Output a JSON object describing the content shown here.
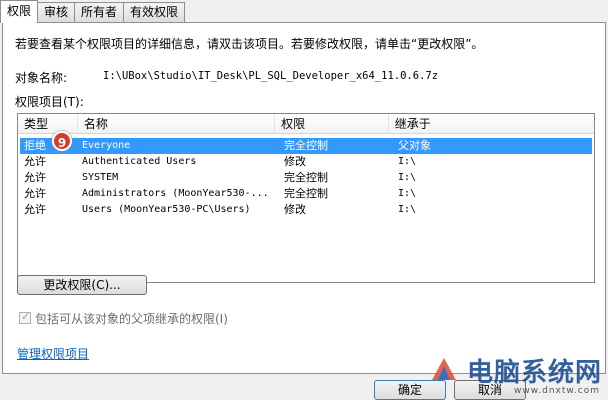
{
  "tabs": [
    "权限",
    "审核",
    "所有者",
    "有效权限"
  ],
  "instruction": "若要查看某个权限项目的详细信息，请双击该项目。若要修改权限，请单击“更改权限”。",
  "object_label": "对象名称:",
  "object_path": "I:\\UBox\\Studio\\IT_Desk\\PL_SQL_Developer_x64_11.0.6.7z",
  "list_label": "权限项目(T):",
  "columns": [
    "类型",
    "名称",
    "权限",
    "继承于"
  ],
  "rows": [
    {
      "type": "拒绝",
      "name": "Everyone",
      "perm": "完全控制",
      "inherit": "父对象"
    },
    {
      "type": "允许",
      "name": "Authenticated Users",
      "perm": "修改",
      "inherit": "I:\\"
    },
    {
      "type": "允许",
      "name": "SYSTEM",
      "perm": "完全控制",
      "inherit": "I:\\"
    },
    {
      "type": "允许",
      "name": "Administrators (MoonYear530-...",
      "perm": "完全控制",
      "inherit": "I:\\"
    },
    {
      "type": "允许",
      "name": "Users (MoonYear530-PC\\Users)",
      "perm": "修改",
      "inherit": "I:\\"
    }
  ],
  "badge": "9",
  "change_button": "更改权限(C)...",
  "inherit_checkbox": "包括可从该对象的父项继承的权限(I)",
  "manage_link": "管理权限项目",
  "ok_button": "确定",
  "cancel_button": "取消",
  "watermark": "电脑系统网",
  "watermark_url": "www.dnxtw.com"
}
